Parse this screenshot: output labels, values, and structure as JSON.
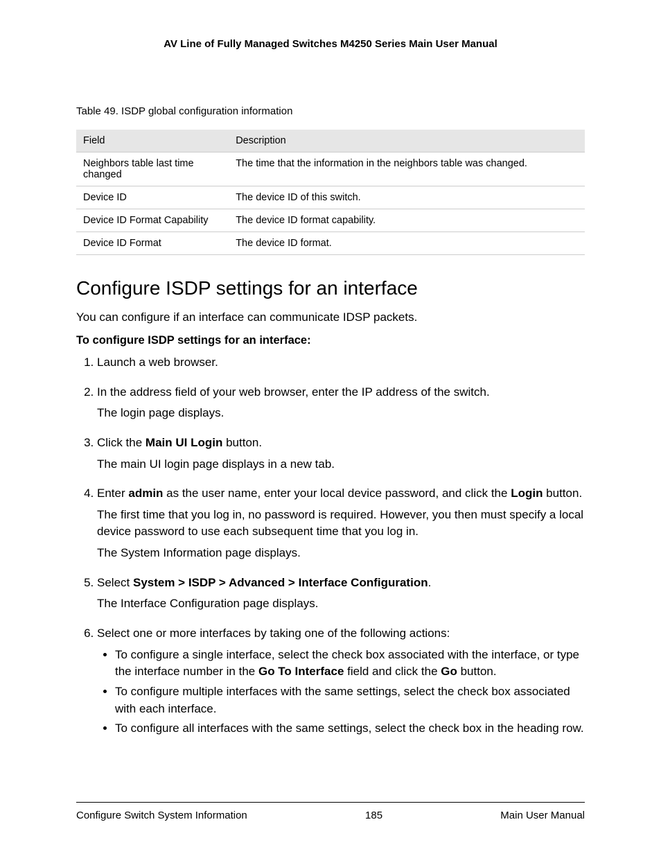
{
  "header": {
    "title": "AV Line of Fully Managed Switches M4250 Series Main User Manual"
  },
  "table": {
    "caption": "Table 49. ISDP global configuration information",
    "columns": [
      "Field",
      "Description"
    ],
    "rows": [
      {
        "field": "Neighbors table last time changed",
        "desc": "The time that the information in the neighbors table was changed."
      },
      {
        "field": "Device ID",
        "desc": "The device ID of this switch."
      },
      {
        "field": "Device ID Format Capability",
        "desc": "The device ID format capability."
      },
      {
        "field": "Device ID Format",
        "desc": "The device ID format."
      }
    ]
  },
  "section": {
    "title": "Configure ISDP settings for an interface",
    "intro": "You can configure if an interface can communicate IDSP packets.",
    "steps_title": "To configure ISDP settings for an interface:"
  },
  "steps": {
    "s1": "Launch a web browser.",
    "s2a": "In the address field of your web browser, enter the IP address of the switch.",
    "s2b": "The login page displays.",
    "s3a_pre": "Click the ",
    "s3a_bold": "Main UI Login",
    "s3a_post": " button.",
    "s3b": "The main UI login page displays in a new tab.",
    "s4a_pre": "Enter ",
    "s4a_bold1": "admin",
    "s4a_mid": " as the user name, enter your local device password, and click the ",
    "s4a_bold2": "Login",
    "s4a_post": " button.",
    "s4b": "The first time that you log in, no password is required. However, you then must specify a local device password to use each subsequent time that you log in.",
    "s4c": "The System Information page displays.",
    "s5a_pre": "Select ",
    "s5a_bold": "System > ISDP > Advanced > Interface Configuration",
    "s5a_post": ".",
    "s5b": "The Interface Configuration page displays.",
    "s6": "Select one or more interfaces by taking one of the following actions:",
    "s6b1_pre": "To configure a single interface, select the check box associated with the interface, or type the interface number in the ",
    "s6b1_bold1": "Go To Interface",
    "s6b1_mid": " field and click the ",
    "s6b1_bold2": "Go",
    "s6b1_post": " button.",
    "s6b2": "To configure multiple interfaces with the same settings, select the check box associated with each interface.",
    "s6b3": "To configure all interfaces with the same settings, select the check box in the heading row."
  },
  "footer": {
    "left": "Configure Switch System Information",
    "center": "185",
    "right": "Main User Manual"
  }
}
